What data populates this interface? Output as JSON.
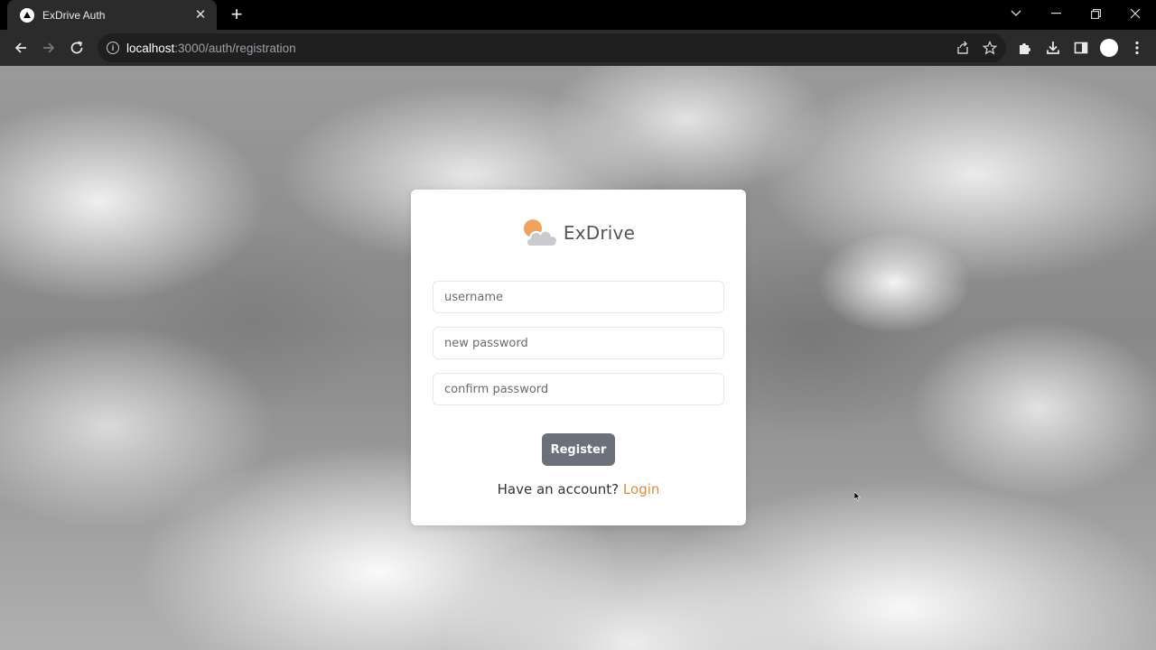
{
  "browser": {
    "tab_title": "ExDrive Auth",
    "tab_close": "✕",
    "new_tab": "+",
    "url_host": "localhost",
    "url_path": ":3000/auth/registration"
  },
  "brand": {
    "name": "ExDrive",
    "logo_sun_color": "#f0a35e",
    "logo_cloud_color": "#c9cbd0"
  },
  "form": {
    "username_placeholder": "username",
    "new_password_placeholder": "new password",
    "confirm_password_placeholder": "confirm password",
    "register_label": "Register",
    "have_account_text": "Have an account?",
    "login_label": "Login"
  },
  "colors": {
    "accent": "#e08a3c",
    "button": "#6b707a"
  }
}
